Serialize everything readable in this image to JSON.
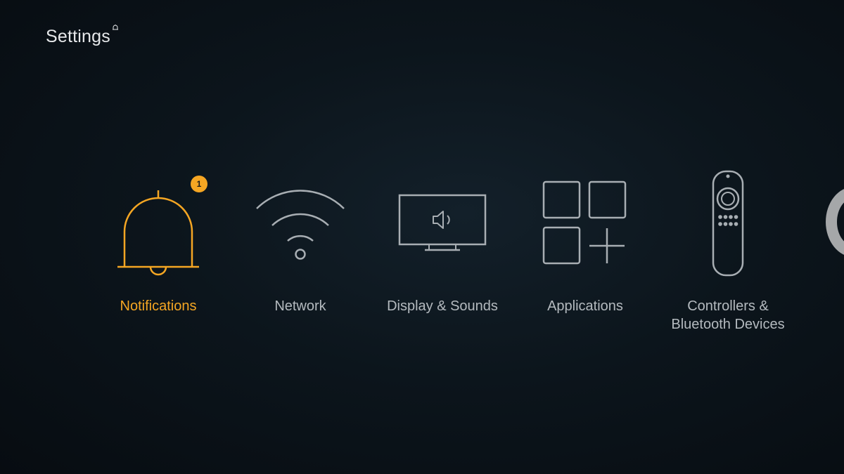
{
  "header": {
    "title": "Settings"
  },
  "menu": {
    "items": [
      {
        "label": "Notifications",
        "icon": "bell-icon",
        "badge": "1",
        "selected": true
      },
      {
        "label": "Network",
        "icon": "wifi-icon"
      },
      {
        "label": "Display & Sounds",
        "icon": "tv-speaker-icon"
      },
      {
        "label": "Applications",
        "icon": "apps-grid-icon"
      },
      {
        "label": "Controllers &\nBluetooth Devices",
        "icon": "remote-control-icon"
      }
    ]
  },
  "colors": {
    "accent": "#f5a623",
    "icon_default": "#a8aeb3",
    "label_default": "#b4babf",
    "background": "#0c151c"
  }
}
